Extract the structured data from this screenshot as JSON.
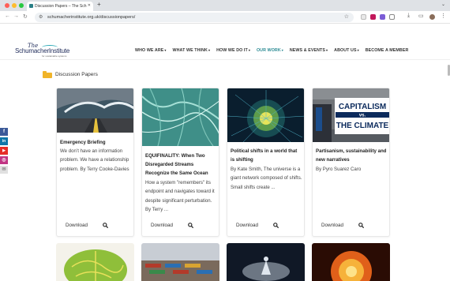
{
  "browser": {
    "tab_title": "Discussion Papers – The Sch",
    "url": "schumacherinstitute.org.uk/discussionpapers/",
    "colors": {
      "close": "#ff5f57",
      "minimize": "#febc2e",
      "maximize": "#28c840"
    }
  },
  "site": {
    "logo_line1": "The",
    "logo_line2": "SchumacherInstitute",
    "logo_tagline": "for sustainable systems",
    "menu": [
      {
        "label": "WHO WE ARE",
        "caret": "▾"
      },
      {
        "label": "WHAT WE THINK",
        "caret": "▾"
      },
      {
        "label": "HOW WE DO IT",
        "caret": "▾"
      },
      {
        "label": "OUR WORK",
        "caret": "▾"
      },
      {
        "label": "NEWS & EVENTS",
        "caret": "▾"
      },
      {
        "label": "ABOUT US",
        "caret": "▾"
      },
      {
        "label": "BECOME A MEMBER",
        "caret": ""
      }
    ],
    "accent": "#2a8a93"
  },
  "breadcrumb": "Discussion Papers",
  "social": [
    "f",
    "in",
    "▶",
    "◎",
    "✉"
  ],
  "cards": [
    {
      "title": "Emergency Briefing",
      "desc": "We don’t have an information problem. We have a relationship problem. By Terry Cooke-Davies",
      "download": "Download"
    },
    {
      "title": "EQUIFINALITY: When Two Disregarded Streams Recognize the Same Ocean",
      "desc": "How a system \"remembers\" its endpoint and navigates toward it despite significant perturbation. By Terry ...",
      "download": "Download"
    },
    {
      "title": "Political shifts in a world that is shifting",
      "desc": "By Kate Smith, The universe is a giant network composed of shifts. Small shifts create ...",
      "download": "Download"
    },
    {
      "title": "Partisanism, sustainability and new narratives",
      "desc": "By Pyro Suarez Caro",
      "download": "Download"
    }
  ],
  "protest_sign": {
    "line1": "CAPITALISM",
    "line2": "vs.",
    "line3": "THE CLIMATE"
  }
}
